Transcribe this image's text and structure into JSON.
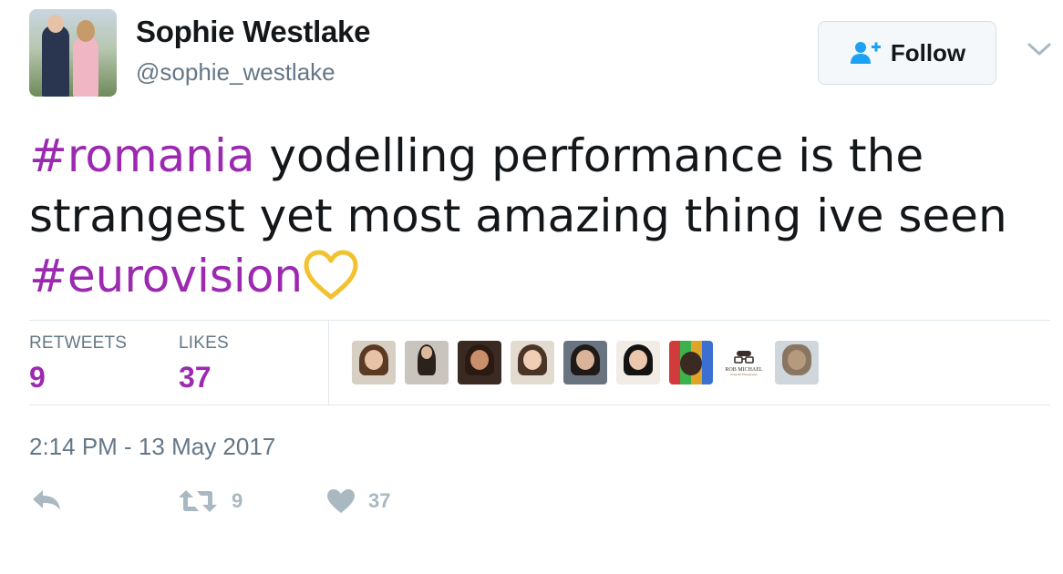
{
  "user": {
    "name": "Sophie Westlake",
    "handle": "@sophie_westlake"
  },
  "follow_button": {
    "label": "Follow"
  },
  "tweet": {
    "hashtag_1": "#romania",
    "text_1": " yodelling performance is the strangest yet most amazing thing ive seen ",
    "hashtag_2": "#eurovision"
  },
  "stats": {
    "retweets_label": "RETWEETS",
    "retweets_value": "9",
    "likes_label": "LIKES",
    "likes_value": "37"
  },
  "likers": {
    "count_shown": 9,
    "rob_michael_name": "ROB MICHAEL",
    "rob_michael_tagline": "Powerful Photography"
  },
  "timestamp": "2:14 PM - 13 May 2017",
  "actions": {
    "retweet_count": "9",
    "like_count": "37"
  },
  "colors": {
    "hashtag": "#9b2ab0",
    "stat_value": "#9b2ab0",
    "muted": "#657786",
    "follow_icon": "#1da1f2",
    "action_icon": "#aab8c2"
  },
  "icons": {
    "follow": "add-user-icon",
    "menu": "chevron-down-icon",
    "reply": "reply-icon",
    "retweet": "retweet-icon",
    "like": "heart-icon",
    "emoji": "yellow-heart-emoji"
  }
}
